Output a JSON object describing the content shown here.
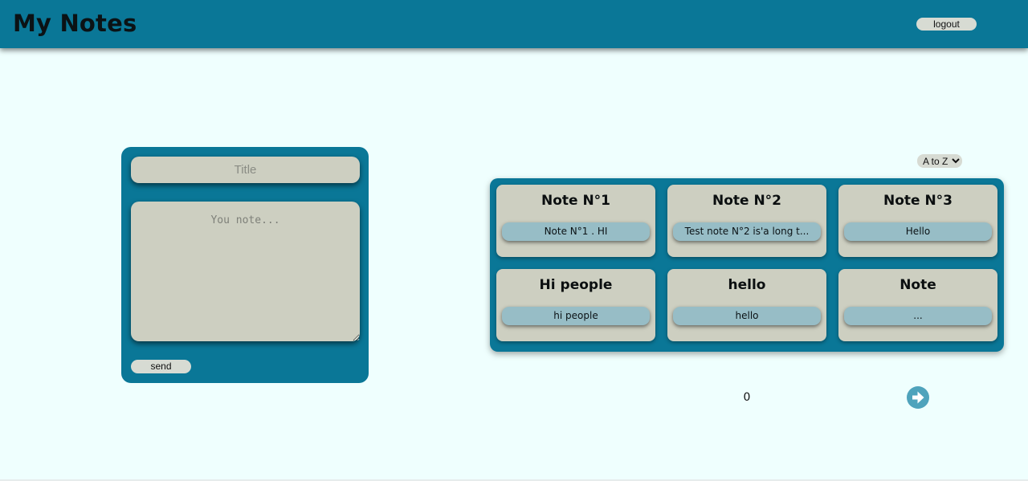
{
  "header": {
    "app_title": "My Notes",
    "logout_label": "logout"
  },
  "form": {
    "title_placeholder": "Title",
    "note_placeholder": "You note...",
    "send_label": "send"
  },
  "sort": {
    "selected": "A to Z"
  },
  "notes": [
    {
      "title": "Note N°1",
      "preview": "Note N°1 . HI"
    },
    {
      "title": "Note N°2",
      "preview": "Test note N°2 is'a long t..."
    },
    {
      "title": "Note N°3",
      "preview": "Hello"
    },
    {
      "title": "Hi people",
      "preview": "hi people"
    },
    {
      "title": "hello",
      "preview": "hello"
    },
    {
      "title": "Note",
      "preview": "..."
    }
  ],
  "pagination": {
    "page": "0",
    "next_icon": "arrow-right-circle-icon"
  },
  "colors": {
    "header_bg": "#0a7797",
    "page_bg": "#effffe",
    "card_bg": "#cdcfc1",
    "preview_bg": "#97bdc6",
    "next_button": "#4fa3bc"
  }
}
